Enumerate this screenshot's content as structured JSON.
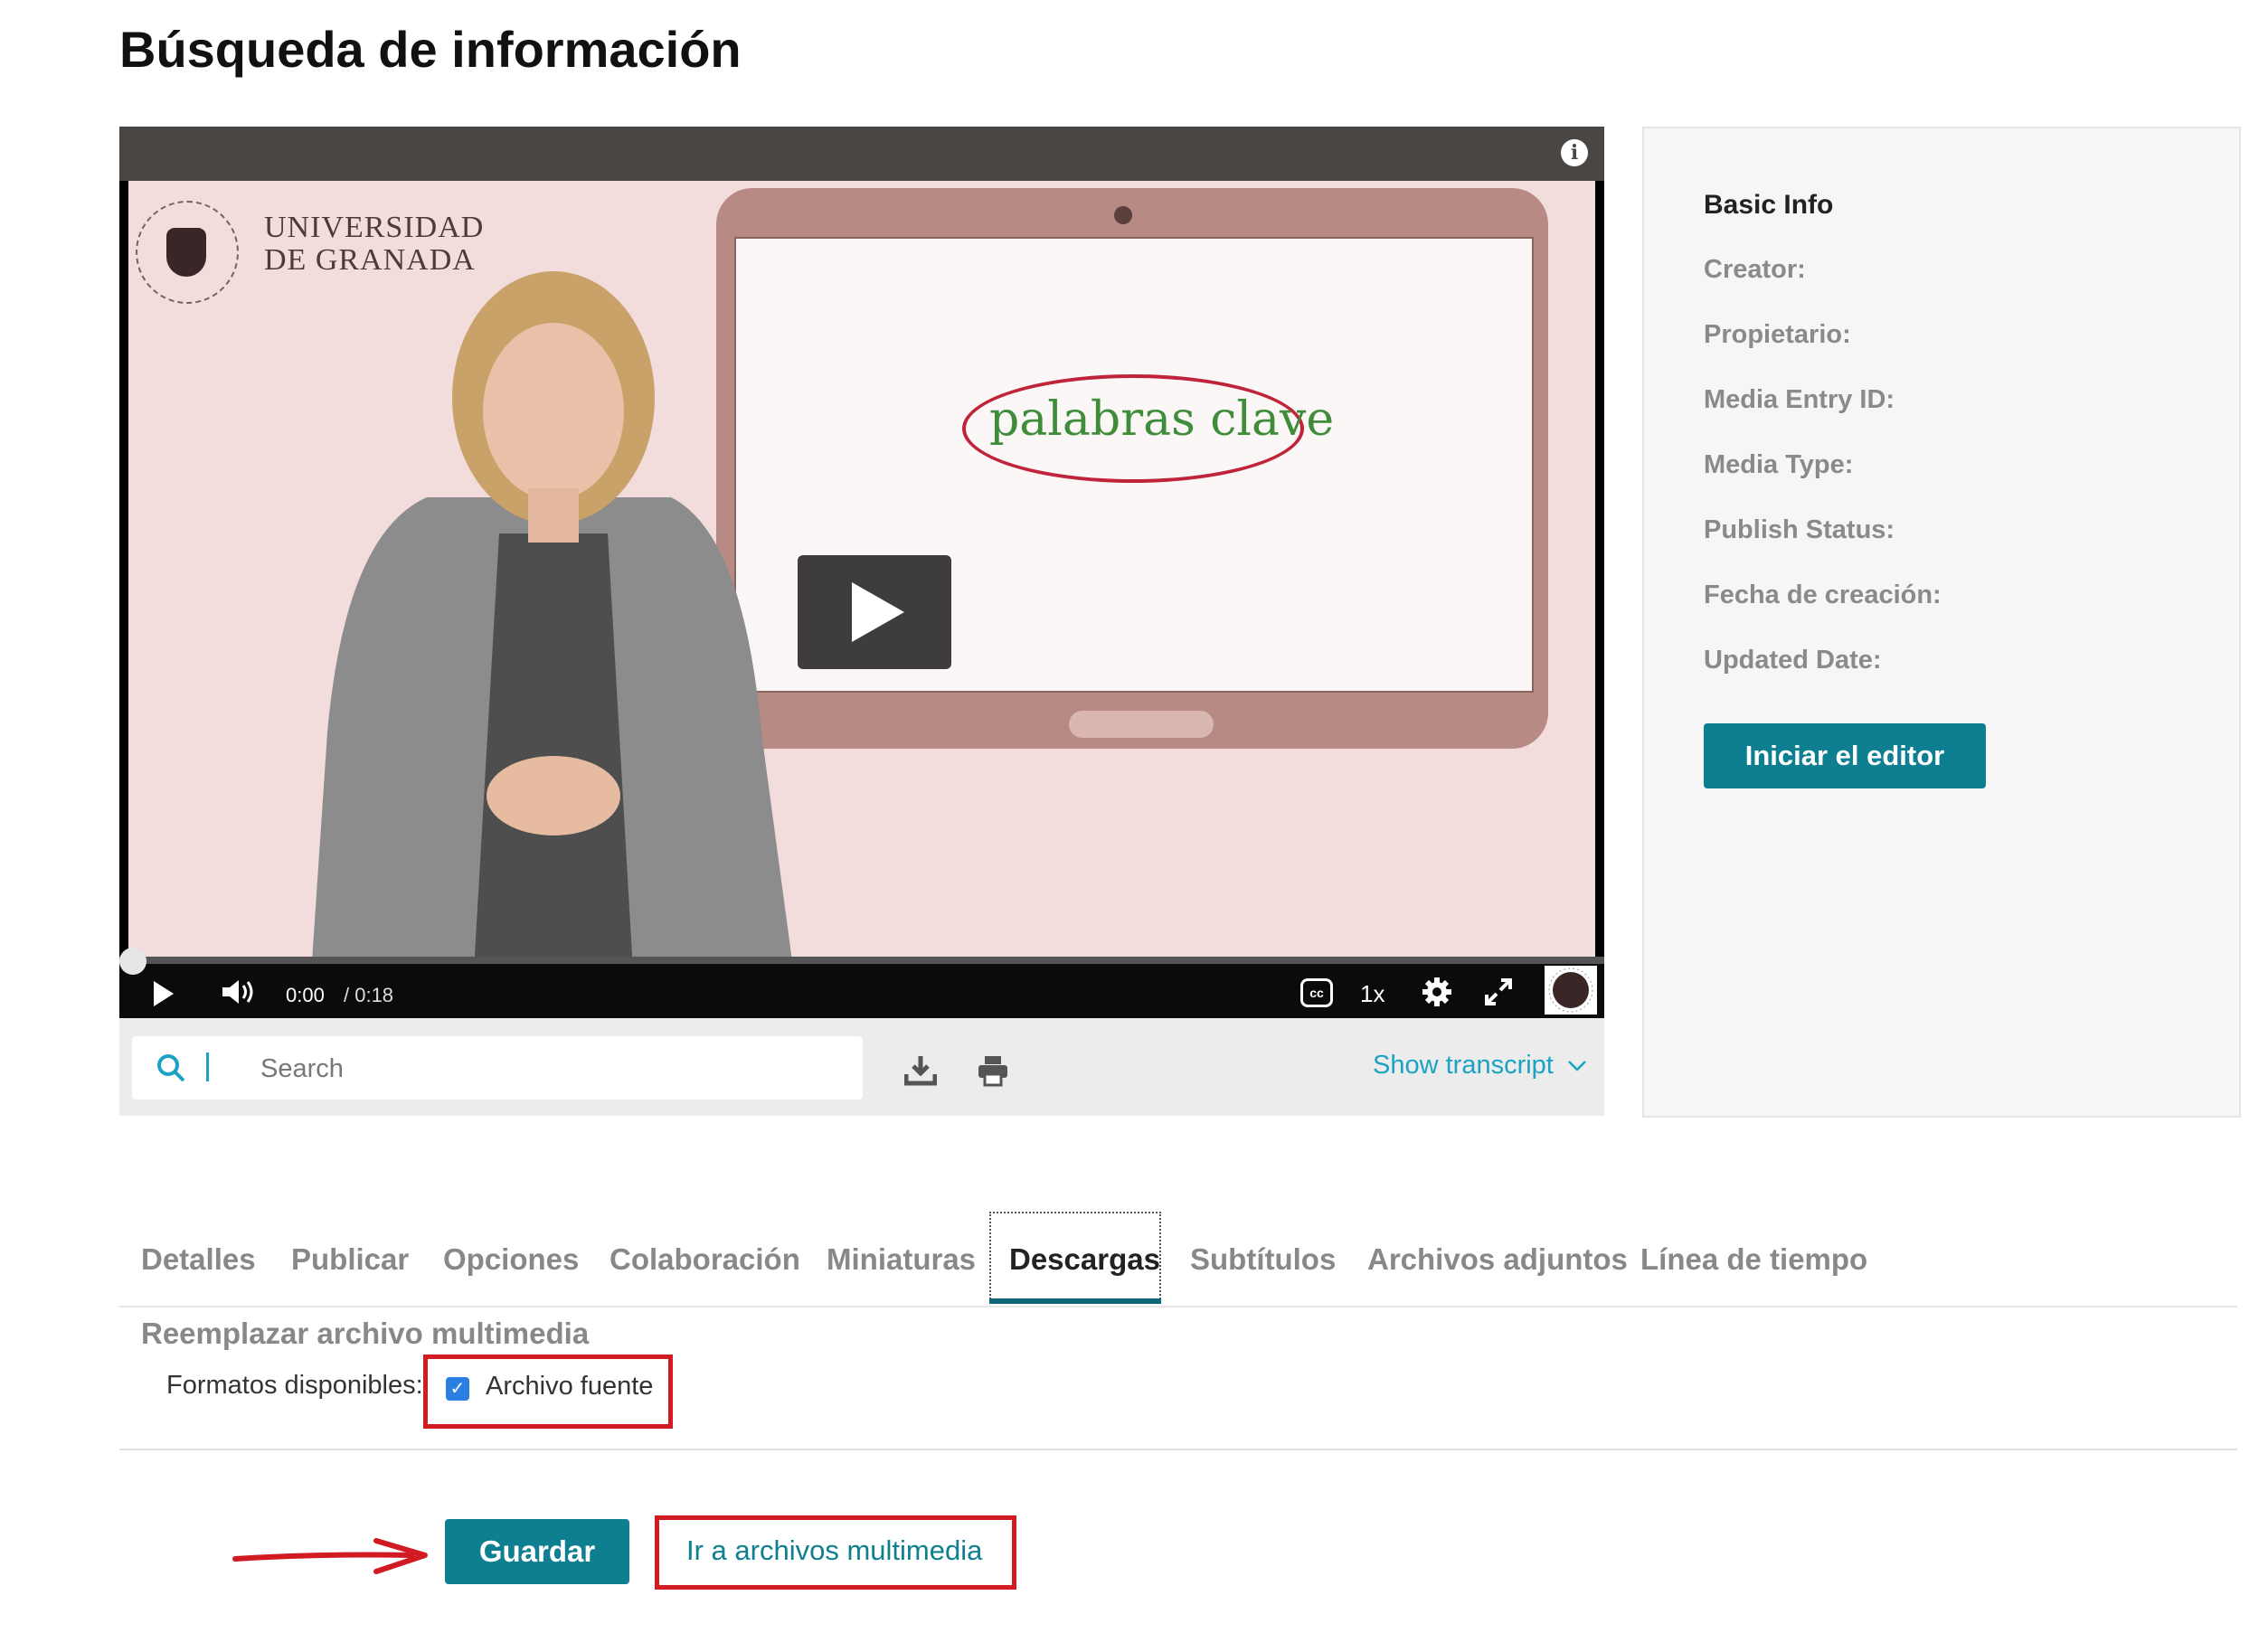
{
  "page": {
    "title": "Búsqueda de información"
  },
  "player": {
    "logo_text_line1": "UNIVERSIDAD",
    "logo_text_line2": "DE GRANADA",
    "slide_text": "palabras clave",
    "time_current": "0:00",
    "time_total": "/ 0:18",
    "speed": "1x",
    "cc": "cc",
    "progress": 0.0
  },
  "transcript": {
    "search_placeholder": "Search",
    "show_transcript": "Show transcript"
  },
  "info_panel": {
    "title": "Basic Info",
    "fields": [
      {
        "label": "Creator:"
      },
      {
        "label": "Propietario:"
      },
      {
        "label": "Media Entry ID:"
      },
      {
        "label": "Media Type:"
      },
      {
        "label": "Publish Status:"
      },
      {
        "label": "Fecha de creación:"
      },
      {
        "label": "Updated Date:"
      }
    ],
    "editor_button": "Iniciar el editor"
  },
  "tabs": [
    {
      "label": "Detalles"
    },
    {
      "label": "Publicar"
    },
    {
      "label": "Opciones"
    },
    {
      "label": "Colaboración"
    },
    {
      "label": "Miniaturas"
    },
    {
      "label": "Descargas",
      "active": true
    },
    {
      "label": "Subtítulos"
    },
    {
      "label": "Archivos adjuntos"
    },
    {
      "label": "Línea de tiempo"
    }
  ],
  "downloads": {
    "section_title": "Reemplazar archivo multimedia",
    "formats_label": "Formatos disponibles:",
    "source_checkbox_label": "Archivo fuente",
    "source_checked": true,
    "save_button": "Guardar",
    "media_link": "Ir a archivos multimedia"
  },
  "colors": {
    "accent": "#0e7f90",
    "link": "#1aa3c2",
    "highlight": "#d11a22"
  },
  "icons": [
    "info-icon",
    "play-icon",
    "volume-icon",
    "cc-icon",
    "gear-icon",
    "fullscreen-icon",
    "search-icon",
    "download-icon",
    "print-icon",
    "chevron-down-icon",
    "arrow-icon"
  ]
}
